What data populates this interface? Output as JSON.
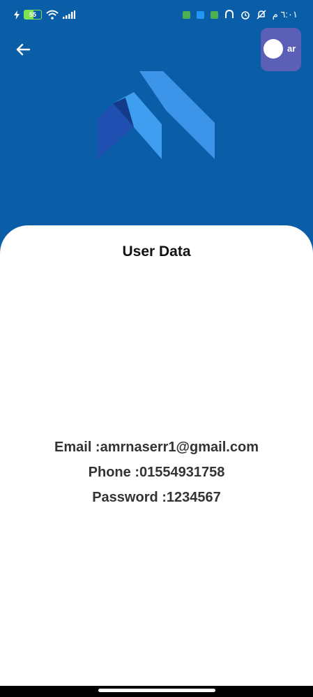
{
  "status_bar": {
    "battery_level": "55",
    "time": "٦:٠١ م",
    "accent_battery": "#7ee34e"
  },
  "header": {
    "back_icon": "arrow-left-icon",
    "language_toggle_label": "ar",
    "background": "#0a5ea8"
  },
  "card": {
    "title": "User Data",
    "email": "Email :amrnaserr1@gmail.com",
    "phone": "Phone :01554931758",
    "password": "Password :1234567"
  }
}
